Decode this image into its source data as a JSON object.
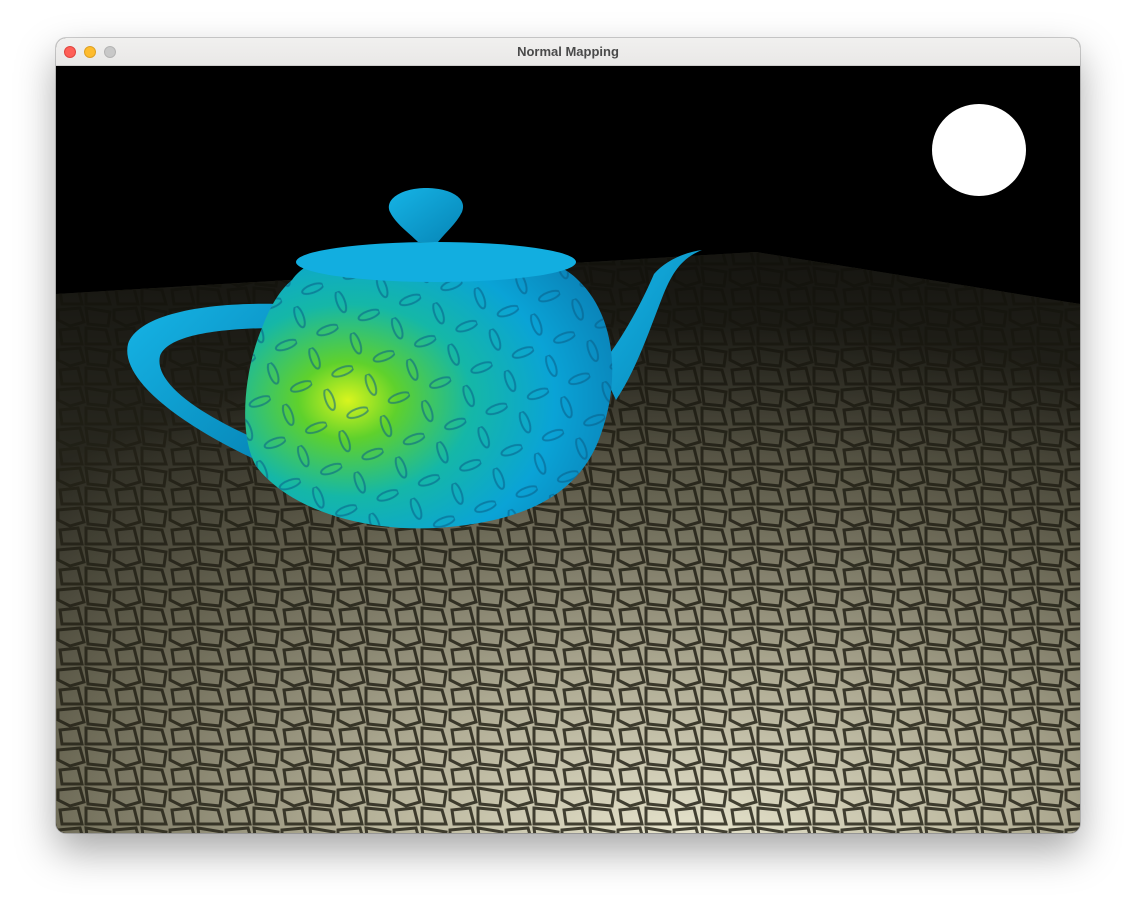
{
  "window": {
    "title": "Normal Mapping"
  },
  "titlebar_buttons": {
    "close": "close-button",
    "minimize": "minimize-button",
    "zoom": "zoom-button"
  },
  "scene": {
    "background_color": "#000000",
    "light_color": "#ffffff",
    "teapot_color": "#0aa3d6",
    "teapot_highlight_color": "#c9ef1c",
    "floor_color": "#8d8a72"
  }
}
